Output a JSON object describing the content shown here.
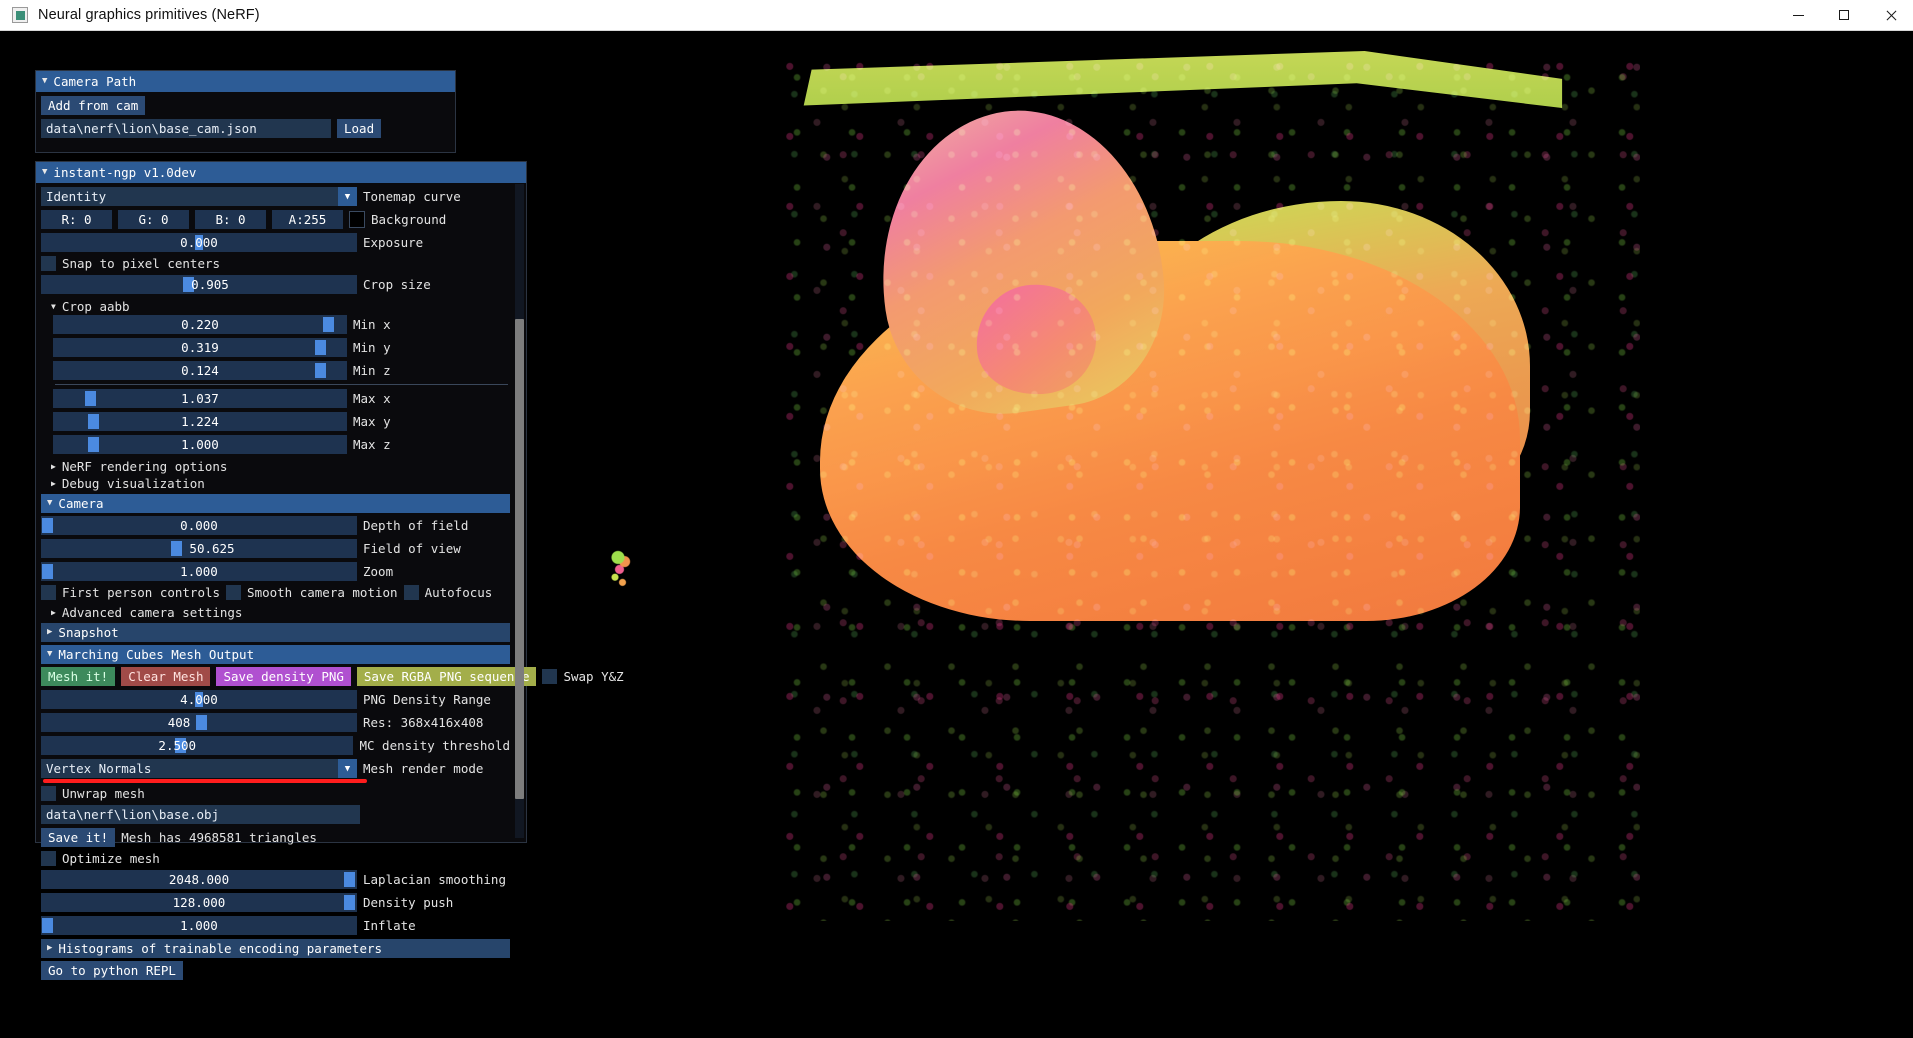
{
  "window": {
    "title": "Neural graphics primitives (NeRF)",
    "app_icon": "app-icon",
    "minimize": "minimize",
    "maximize": "maximize",
    "close": "close"
  },
  "camera_path_panel": {
    "title": "Camera Path",
    "add_from_cam": "Add from cam",
    "path_value": "data\\nerf\\lion\\base_cam.json",
    "load": "Load"
  },
  "main_panel": {
    "title": "instant-ngp v1.0dev",
    "tonemap": {
      "value": "Identity",
      "label": "Tonemap curve"
    },
    "background": {
      "r": "R:  0",
      "g": "G:  0",
      "b": "B:  0",
      "a": "A:255",
      "label": "Background",
      "swatch_color": "#000000"
    },
    "exposure": {
      "value_prefix": "0.",
      "value_highlight": "0",
      "value_suffix": "00",
      "label": "Exposure",
      "fill": 0
    },
    "snap_to_pixel_centers": {
      "label": "Snap to pixel centers",
      "checked": false
    },
    "crop_size": {
      "value": "0.905",
      "label": "Crop size",
      "grab_pct": 45
    },
    "crop_aabb": {
      "label": "Crop aabb",
      "open": true,
      "rows": [
        {
          "value": "0.220",
          "label": "Min x",
          "grab_pct": 92
        },
        {
          "value": "0.319",
          "label": "Min y",
          "grab_pct": 89
        },
        {
          "value": "0.124",
          "label": "Min z",
          "grab_pct": 89
        },
        {
          "value": "1.037",
          "label": "Max x",
          "grab_pct": 11
        },
        {
          "value": "1.224",
          "label": "Max y",
          "grab_pct": 12
        },
        {
          "value": "1.000",
          "label": "Max z",
          "grab_pct": 12
        }
      ]
    },
    "nerf_rendering_options": "NeRF rendering options",
    "debug_visualization": "Debug visualization",
    "camera": {
      "title": "Camera",
      "depth_of_field": {
        "value": "0.000",
        "label": "Depth of field",
        "grab_pct": 0
      },
      "field_of_view": {
        "value": "50.625",
        "label": "Field of view",
        "grab_pct": 41
      },
      "zoom": {
        "value": "1.000",
        "label": "Zoom",
        "grab_pct": 0
      },
      "first_person_controls": {
        "label": "First person controls",
        "checked": false
      },
      "smooth_camera_motion": {
        "label": "Smooth camera motion",
        "checked": false
      },
      "autofocus": {
        "label": "Autofocus",
        "checked": false
      },
      "advanced_camera_settings": "Advanced camera settings"
    },
    "snapshot": {
      "title": "Snapshot",
      "open": false
    },
    "marching_cubes": {
      "title": "Marching Cubes Mesh Output",
      "open": true,
      "mesh_it": "Mesh it!",
      "clear_mesh": "Clear Mesh",
      "save_density_png": "Save density PNG",
      "save_rgba_png_sequence": "Save RGBA PNG sequence",
      "swap_yz": {
        "label": "Swap Y&Z",
        "checked": false
      },
      "png_density_range": {
        "value_prefix": "4.",
        "value_highlight": "0",
        "value_suffix": "00",
        "label": "PNG Density Range"
      },
      "resolution": {
        "value": "408",
        "label": "Res: 368x416x408",
        "grab_pct": 49
      },
      "mc_density_threshold": {
        "value": "2.500",
        "label": "MC density threshold",
        "grab_pct": 43
      },
      "mesh_render_mode": {
        "value": "Vertex Normals",
        "label": "Mesh render mode"
      },
      "unwrap_mesh": {
        "label": "Unwrap mesh",
        "checked": false
      },
      "obj_path": "data\\nerf\\lion\\base.obj",
      "save_it": "Save it!",
      "mesh_stats": "Mesh has 4968581 triangles",
      "optimize_mesh": {
        "label": "Optimize mesh",
        "checked": false
      },
      "laplacian_smoothing": {
        "value": "2048.000",
        "label": "Laplacian smoothing",
        "grab_pct": 96
      },
      "density_push": {
        "value": "128.000",
        "label": "Density push",
        "grab_pct": 96
      },
      "inflate": {
        "value": "1.000",
        "label": "Inflate",
        "grab_pct": 1
      }
    },
    "histograms": "Histograms of trainable encoding parameters",
    "go_to_python_repl": "Go to python REPL",
    "annotation_highlight_color": "#ff1d1d"
  }
}
